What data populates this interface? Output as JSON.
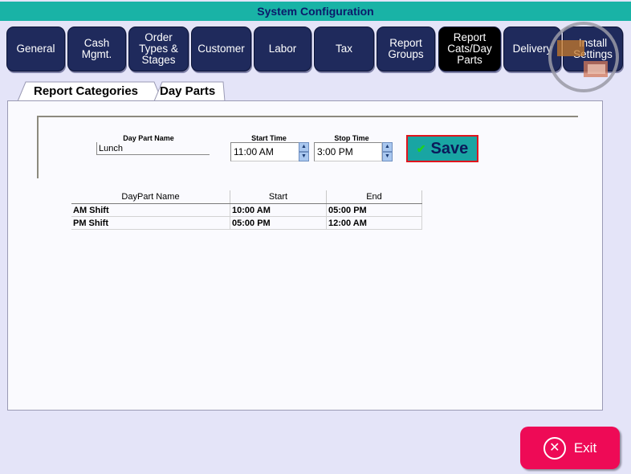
{
  "window": {
    "title": "System Configuration"
  },
  "nav_tabs": [
    {
      "lines": [
        "General"
      ]
    },
    {
      "lines": [
        "Cash",
        "Mgmt."
      ]
    },
    {
      "lines": [
        "Order",
        "Types &",
        "Stages"
      ]
    },
    {
      "lines": [
        "Customer"
      ]
    },
    {
      "lines": [
        "Labor"
      ]
    },
    {
      "lines": [
        "Tax"
      ]
    },
    {
      "lines": [
        "Report",
        "Groups"
      ]
    },
    {
      "lines": [
        "Report",
        "Cats/Day",
        "Parts"
      ],
      "active": true
    },
    {
      "lines": [
        "Delivery"
      ]
    },
    {
      "lines": [
        "Install",
        "Settings"
      ]
    }
  ],
  "sub_tabs": {
    "report_categories": "Report Categories",
    "day_parts": "Day Parts"
  },
  "form": {
    "name_label": "Day Part Name",
    "name_value": "Lunch",
    "start_label": "Start Time",
    "start_value": "11:00 AM",
    "stop_label": "Stop Time",
    "stop_value": "3:00 PM",
    "save_label": "Save"
  },
  "table": {
    "headers": [
      "DayPart Name",
      "Start",
      "End"
    ],
    "rows": [
      [
        "AM Shift",
        "10:00 AM",
        "05:00 PM"
      ],
      [
        "PM Shift",
        "05:00 PM",
        "12:00 AM"
      ]
    ]
  },
  "exit_label": "Exit",
  "colors": {
    "title_bar": "#19b3a6",
    "tab": "#1f2a5c",
    "save": "#19a5a3",
    "exit": "#ee0a56"
  }
}
